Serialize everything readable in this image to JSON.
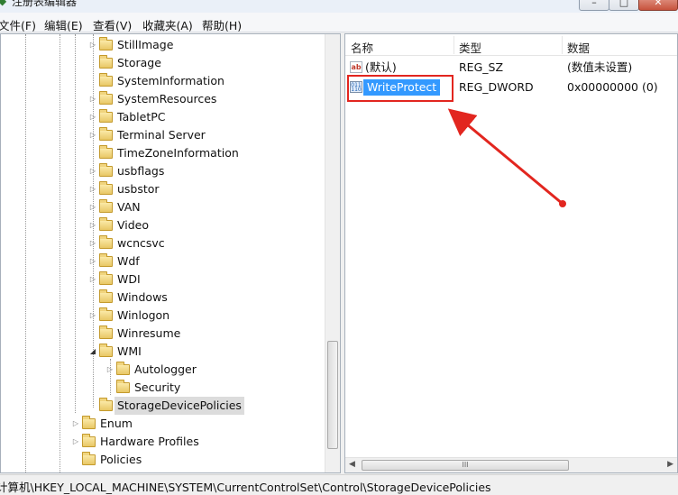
{
  "window": {
    "title": "注册表编辑器"
  },
  "menu": [
    {
      "label": "文件(F)"
    },
    {
      "label": "编辑(E)"
    },
    {
      "label": "查看(V)"
    },
    {
      "label": "收藏夹(A)"
    },
    {
      "label": "帮助(H)"
    }
  ],
  "tree": {
    "items": [
      {
        "label": "StillImage",
        "expander": "▷"
      },
      {
        "label": "Storage",
        "expander": ""
      },
      {
        "label": "SystemInformation",
        "expander": ""
      },
      {
        "label": "SystemResources",
        "expander": "▷"
      },
      {
        "label": "TabletPC",
        "expander": "▷"
      },
      {
        "label": "Terminal Server",
        "expander": "▷"
      },
      {
        "label": "TimeZoneInformation",
        "expander": ""
      },
      {
        "label": "usbflags",
        "expander": "▷"
      },
      {
        "label": "usbstor",
        "expander": "▷"
      },
      {
        "label": "VAN",
        "expander": "▷"
      },
      {
        "label": "Video",
        "expander": "▷"
      },
      {
        "label": "wcncsvc",
        "expander": "▷"
      },
      {
        "label": "Wdf",
        "expander": "▷"
      },
      {
        "label": "WDI",
        "expander": "▷"
      },
      {
        "label": "Windows",
        "expander": ""
      },
      {
        "label": "Winlogon",
        "expander": "▷"
      },
      {
        "label": "Winresume",
        "expander": ""
      },
      {
        "label": "WMI",
        "expander": "◢"
      },
      {
        "label": "Autologger",
        "expander": "▷"
      },
      {
        "label": "Security",
        "expander": ""
      },
      {
        "label": "StorageDevicePolicies",
        "expander": "",
        "selected": true
      },
      {
        "label": "Enum",
        "expander": "▷"
      },
      {
        "label": "Hardware Profiles",
        "expander": "▷"
      },
      {
        "label": "Policies",
        "expander": ""
      }
    ]
  },
  "list": {
    "columns": {
      "name": "名称",
      "type": "类型",
      "data": "数据"
    },
    "rows": [
      {
        "icon": "string-value-icon",
        "icon_text": "ab",
        "name": "(默认)",
        "type": "REG_SZ",
        "data": "(数值未设置)"
      },
      {
        "icon": "binary-value-icon",
        "icon_text": "011 110",
        "name": "WriteProtect",
        "type": "REG_DWORD",
        "data": "0x00000000 (0)"
      }
    ],
    "hscroll_thumb": "III"
  },
  "status": {
    "path": "计算机\\HKEY_LOCAL_MACHINE\\SYSTEM\\CurrentControlSet\\Control\\StorageDevicePolicies"
  },
  "colors": {
    "annotation": "#e2261f",
    "selection": "#3399ff"
  }
}
